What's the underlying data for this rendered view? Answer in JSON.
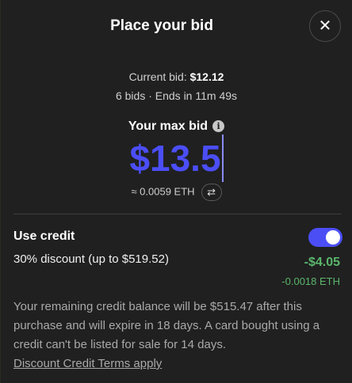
{
  "modal": {
    "title": "Place your bid",
    "close_symbol": "✕",
    "close_icon": "close-icon"
  },
  "auction": {
    "current_bid_label": "Current bid:",
    "current_bid_value": "$12.12",
    "bids_line": "6 bids · Ends in 11m 49s"
  },
  "bid": {
    "max_bid_label": "Your max bid",
    "info_icon": "info-icon",
    "info_symbol": "i",
    "amount": "$13.5",
    "eth_equivalent": "≈ 0.0059 ETH",
    "swap_icon": "swap-icon",
    "swap_symbol": "⇄"
  },
  "credit": {
    "label": "Use credit",
    "toggle_on": true,
    "discount_text": "30% discount (up to $519.52)",
    "discount_usd": "-$4.05",
    "discount_eth": "-0.0018 ETH",
    "notice": "Your remaining credit balance will be $515.47 after this purchase and will expire in 18 days. A card bought using a credit can't be listed for sale for 14 days.",
    "terms_link": "Discount Credit Terms apply"
  },
  "colors": {
    "accent": "#4b4ef5",
    "positive": "#5ab66c",
    "background": "#202020"
  }
}
